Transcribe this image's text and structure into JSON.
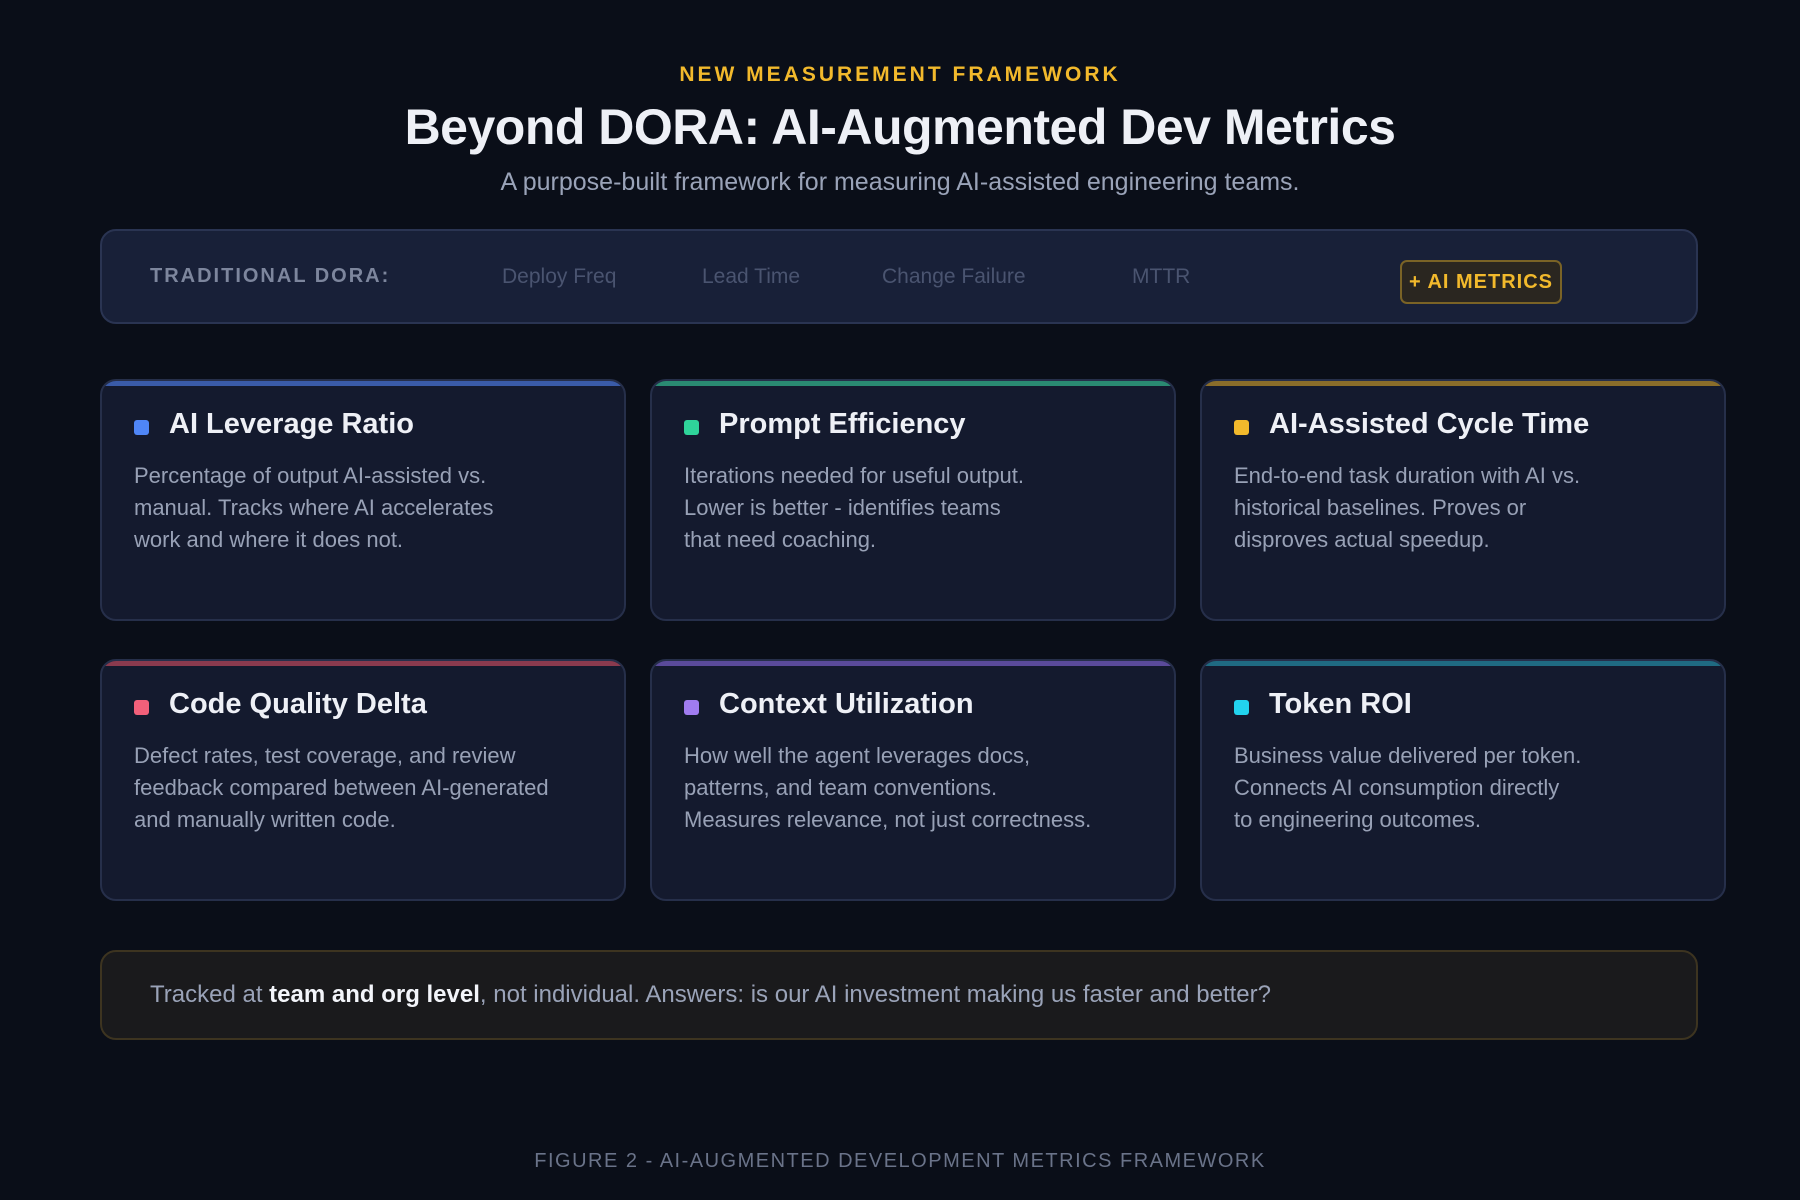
{
  "header": {
    "eyebrow": "NEW MEASUREMENT FRAMEWORK",
    "title": "Beyond DORA: AI-Augmented Dev Metrics",
    "subtitle": "A purpose-built framework for measuring AI-assisted engineering teams."
  },
  "dora": {
    "label": "TRADITIONAL DORA:",
    "items": [
      "Deploy Freq",
      "Lead Time",
      "Change Failure",
      "MTTR"
    ],
    "badge": "+ AI METRICS"
  },
  "cards": [
    {
      "title": "AI Leverage Ratio",
      "color": "#4f86f7",
      "accent": "#3a5ba8",
      "lines": [
        "Percentage of output AI-assisted vs.",
        "manual. Tracks where AI accelerates",
        "work and where it does not."
      ]
    },
    {
      "title": "Prompt Efficiency",
      "color": "#2fd49a",
      "accent": "#2a8a72",
      "lines": [
        "Iterations needed for useful output.",
        "Lower is better - identifies teams",
        "that need coaching."
      ]
    },
    {
      "title": "AI-Assisted Cycle Time",
      "color": "#f2b92c",
      "accent": "#8a6d2a",
      "lines": [
        "End-to-end task duration with AI vs.",
        "historical baselines. Proves or",
        "disproves actual speedup."
      ]
    },
    {
      "title": "Code Quality Delta",
      "color": "#f2607a",
      "accent": "#8a3a4e",
      "lines": [
        "Defect rates, test coverage, and review",
        "feedback compared between AI-generated",
        "and manually written code."
      ]
    },
    {
      "title": "Context Utilization",
      "color": "#a07cf0",
      "accent": "#5a4a9a",
      "lines": [
        "How well the agent leverages docs,",
        "patterns, and team conventions.",
        "Measures relevance, not just correctness."
      ]
    },
    {
      "title": "Token ROI",
      "color": "#22d3ee",
      "accent": "#1f6a82",
      "lines": [
        "Business value delivered per token.",
        "Connects AI consumption directly",
        "to engineering outcomes."
      ]
    }
  ],
  "note": {
    "prefix": "Tracked at ",
    "bold": "team and org level",
    "suffix": ", not individual. Answers: is our AI investment making us faster and better?"
  },
  "caption": "FIGURE 2 - AI-AUGMENTED DEVELOPMENT METRICS FRAMEWORK"
}
